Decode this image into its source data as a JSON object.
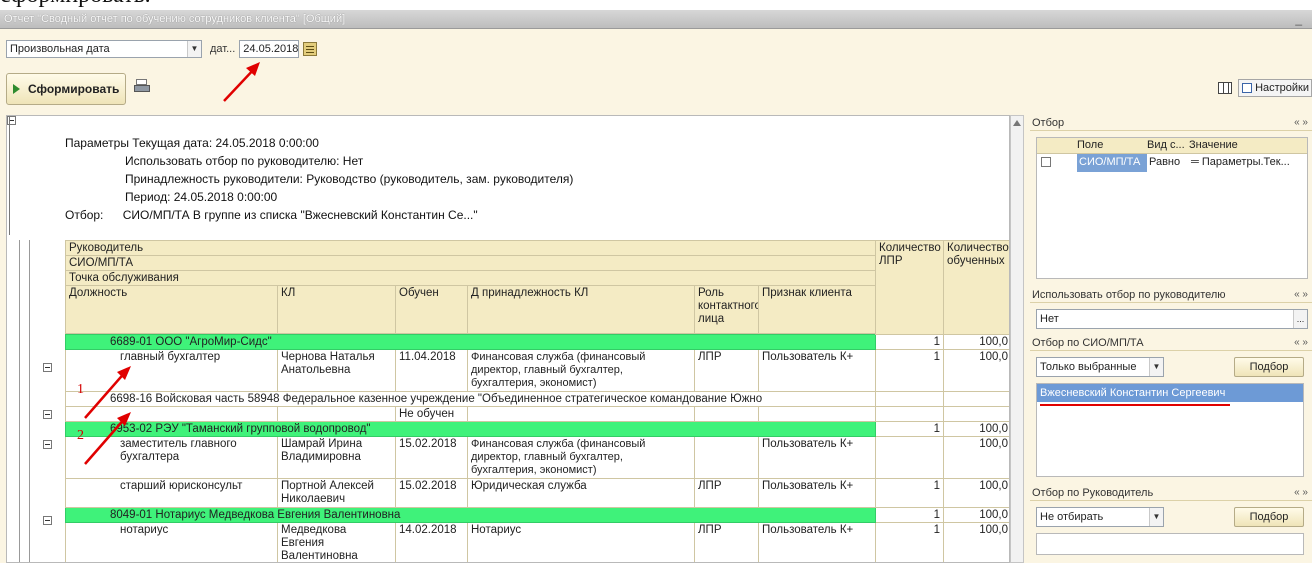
{
  "top_text": "сформировать.",
  "window": {
    "title": "Отчет \"Сводный отчет по обучению сотрудников клиента\" [Общий]",
    "minimize": "_"
  },
  "params_bar": {
    "period_type": "Произвольная дата",
    "date_label": "дат...",
    "date_value": "24.05.2018"
  },
  "toolbar": {
    "form_button": "Сформировать",
    "settings_button": "Настройки"
  },
  "report": {
    "params_lines": [
      "Параметры Текущая дата: 24.05.2018 0:00:00",
      "Использовать отбор по руководителю: Нет",
      "Принадлежность руководители: Руководство (руководитель, зам. руководителя)",
      "Период: 24.05.2018 0:00:00"
    ],
    "filter_label": "Отбор:",
    "filter_value": "СИО/МП/ТА В группе из списка \"Вжесневский Константин Се...\"",
    "headers": {
      "manager": "Руководитель",
      "sio": "СИО/МП/ТА",
      "point": "Точка обслуживания",
      "position": "Должность",
      "kl": "КЛ",
      "trained": "Обучен",
      "d_kl": "Д принадлежность КЛ",
      "role": "Роль контактного лица",
      "client_sign": "Признак клиента",
      "count_lpr": "Количество ЛПР",
      "count_trained": "Количество обученных"
    },
    "rows": [
      {
        "kind": "group",
        "text": "6689-01 ООО \"АгроМир-Сидс\"",
        "c1": "1",
        "c2": "100,0"
      },
      {
        "kind": "detail",
        "position": "главный бухгалтер",
        "kl": "Чернова Наталья Анатольевна",
        "trained": "11.04.2018",
        "d_kl": "Финансовая служба (финансовый директор, главный бухгалтер, бухгалтерия, экономист)",
        "role": "ЛПР",
        "client_sign": "Пользователь К+",
        "c1": "1",
        "c2": "100,0"
      },
      {
        "kind": "plain",
        "text": "6698-16 Войсковая часть 58948 Федеральное казенное учреждение \"Объединенное стратегическое командование Южно",
        "c1": "",
        "c2": ""
      },
      {
        "kind": "detail",
        "position": "",
        "kl": "",
        "trained": "Не обучен",
        "d_kl": "",
        "role": "",
        "client_sign": "",
        "c1": "",
        "c2": ""
      },
      {
        "kind": "group",
        "text": "6953-02 РЭУ \"Таманский групповой водопровод\"",
        "c1": "1",
        "c2": "100,0"
      },
      {
        "kind": "detail",
        "position": "заместитель главного бухгалтера",
        "kl": "Шамрай Ирина Владимировна",
        "trained": "15.02.2018",
        "d_kl": "Финансовая служба (финансовый директор, главный бухгалтер, бухгалтерия, экономист)",
        "role": "",
        "client_sign": "Пользователь К+",
        "c1": "",
        "c2": "100,0"
      },
      {
        "kind": "detail",
        "position": "старший юрисконсульт",
        "kl": "Портной Алексей Николаевич",
        "trained": "15.02.2018",
        "d_kl": "Юридическая служба",
        "role": "ЛПР",
        "client_sign": "Пользователь К+",
        "c1": "1",
        "c2": "100,0"
      },
      {
        "kind": "group",
        "text": "8049-01 Нотариус Медведкова Евгения Валентиновна",
        "c1": "1",
        "c2": "100,0"
      },
      {
        "kind": "detail",
        "position": "нотариус",
        "kl": "Медведкова Евгения Валентиновна",
        "trained": "14.02.2018",
        "d_kl": "Нотариус",
        "role": "ЛПР",
        "client_sign": "Пользователь К+",
        "c1": "1",
        "c2": "100,0"
      }
    ],
    "marks": [
      "1",
      "2"
    ]
  },
  "side": {
    "filter": {
      "title": "Отбор",
      "col_field": "Поле",
      "col_kind": "Вид с...",
      "col_value": "Значение",
      "row_field": "СИО/МП/ТА",
      "row_kind": "Равно",
      "row_value": "Параметры.Тек..."
    },
    "by_manager": {
      "title": "Использовать отбор по руководителю",
      "value": "Нет"
    },
    "by_sio": {
      "title": "Отбор по СИО/МП/ТА",
      "mode": "Только выбранные",
      "pick": "Подбор",
      "selected": "Вжесневский Константин Сергеевич"
    },
    "by_head": {
      "title": "Отбор по Руководитель",
      "mode": "Не отбирать",
      "pick": "Подбор"
    },
    "chevron": "« »"
  }
}
